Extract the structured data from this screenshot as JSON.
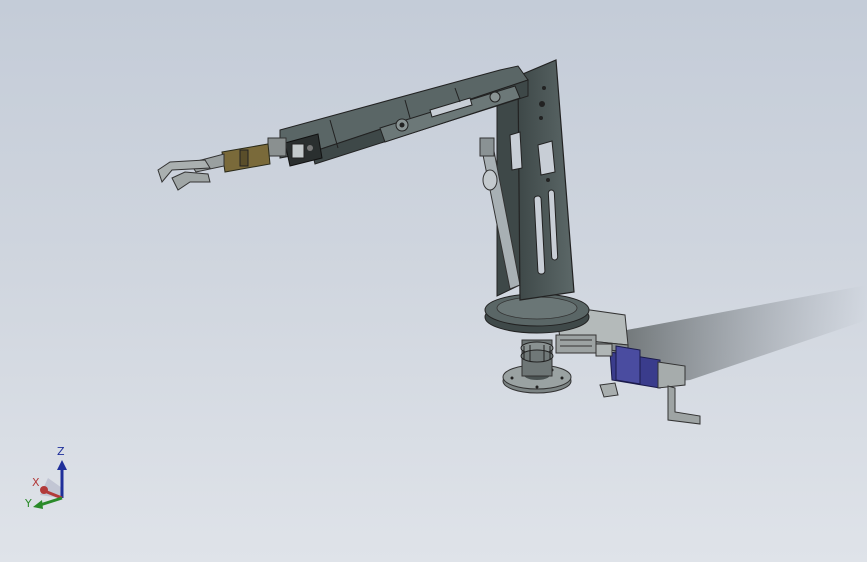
{
  "viewport": {
    "background_top": "#c4ccd8",
    "background_bottom": "#dfe3e9"
  },
  "model": {
    "name": "robotic-arm-assembly",
    "frame_color": "#4e5a5a",
    "frame_dark": "#3a4444",
    "gripper_color": "#7a6a3a",
    "motor_color": "#3a3c8c",
    "rail_color": "#9aa0a0"
  },
  "triad": {
    "z_label": "Z",
    "x_label": "X",
    "y_label": "Y",
    "z_color": "#1f2f9a",
    "x_color": "#b23a3a",
    "y_color": "#2a8a2a"
  }
}
